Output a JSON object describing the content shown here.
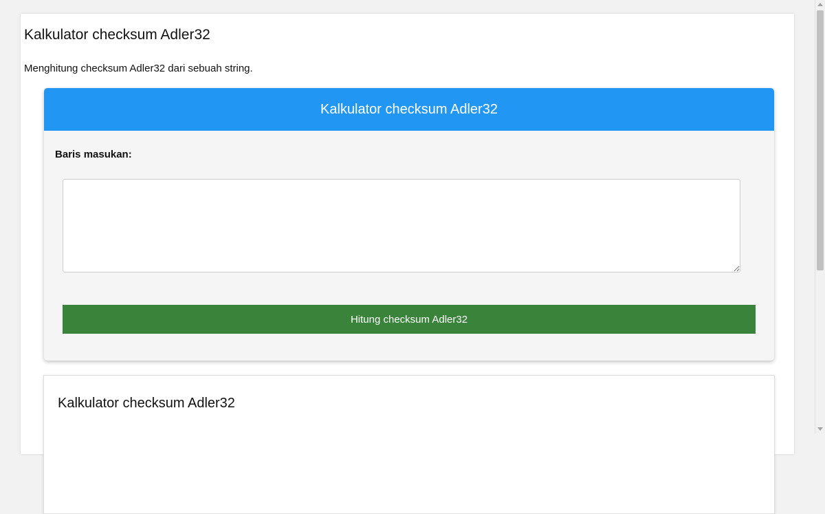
{
  "page": {
    "title": "Kalkulator checksum Adler32",
    "description": "Menghitung checksum Adler32 dari sebuah string."
  },
  "tool": {
    "header": "Kalkulator checksum Adler32",
    "input_label": "Baris masukan:",
    "input_value": "",
    "button_label": "Hitung checksum Adler32"
  },
  "info": {
    "title": "Kalkulator checksum Adler32",
    "text": ""
  },
  "scrollbar": {
    "position_fraction": 0.0,
    "visible_fraction": 0.63
  },
  "colors": {
    "header_blue": "#2196f3",
    "button_green": "#3a833a",
    "card_background": "#f5f5f5"
  }
}
